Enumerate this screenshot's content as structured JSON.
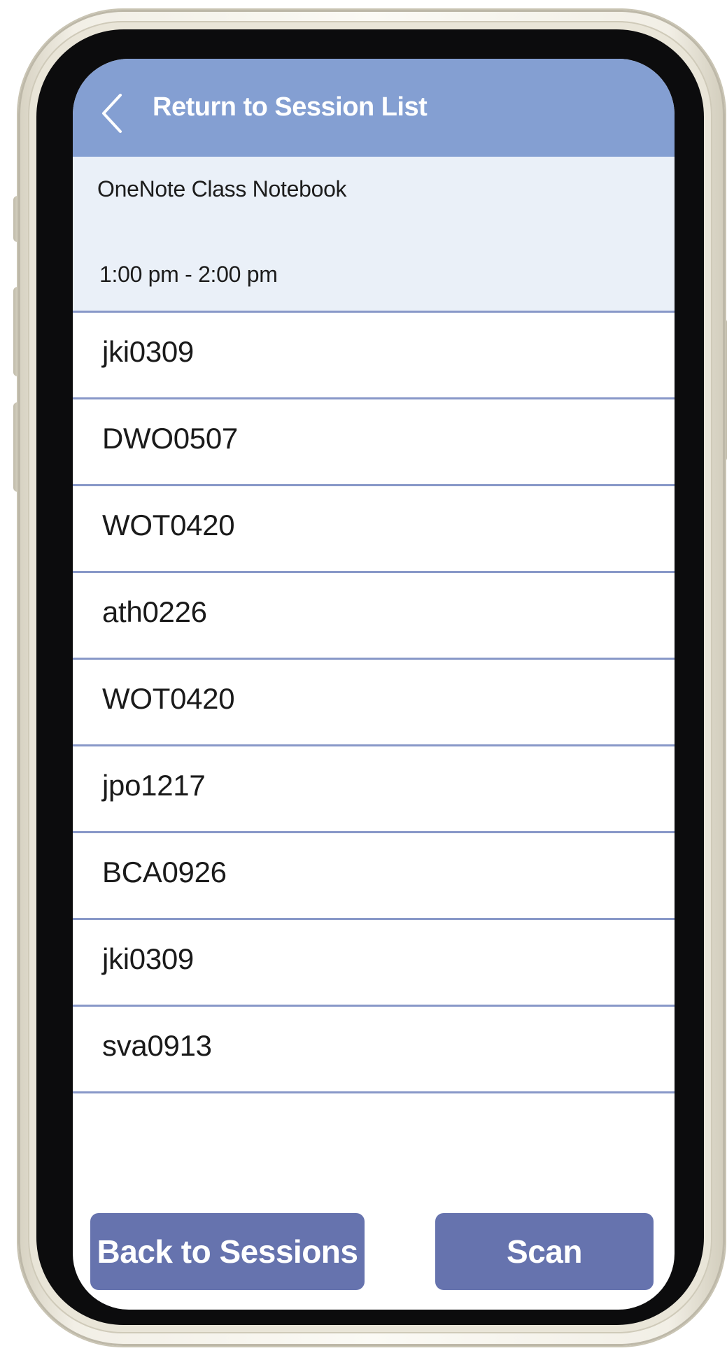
{
  "header": {
    "back_label": "Return to Session List",
    "back_icon": "chevron-left-icon"
  },
  "session": {
    "course": "OneNote Class Notebook",
    "time": "1:00 pm - 2:00 pm"
  },
  "attendees": [
    "jki0309",
    "DWO0507",
    "WOT0420",
    "ath0226",
    "WOT0420",
    "jpo1217",
    "BCA0926",
    "jki0309",
    "sva0913"
  ],
  "actions": {
    "back_to_sessions": "Back to Sessions",
    "scan": "Scan"
  },
  "colors": {
    "header": "#849fd2",
    "info_background": "#eaf0f8",
    "divider": "#8898c8",
    "button": "#6673ae"
  }
}
